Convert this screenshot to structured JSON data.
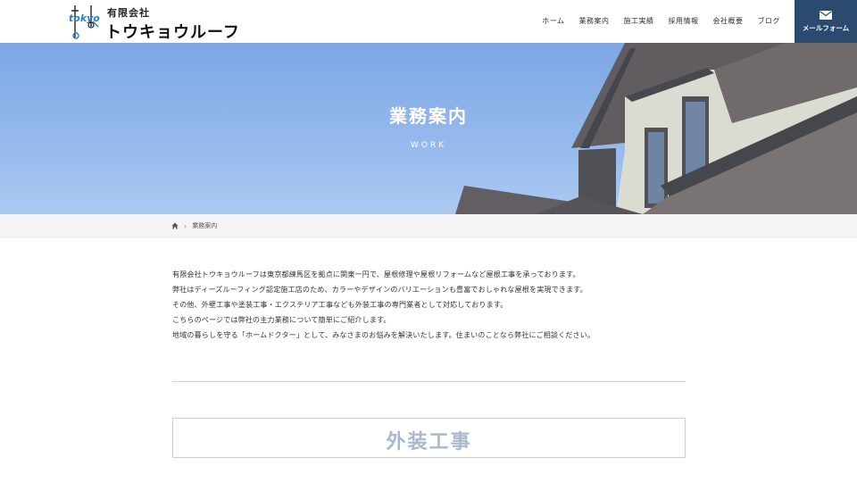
{
  "header": {
    "company_prefix": "有限会社",
    "company_name": "トウキョウルーフ",
    "logo_text": "tokyo",
    "nav": [
      "ホーム",
      "業務案内",
      "施工実績",
      "採用情報",
      "会社概要",
      "ブログ"
    ],
    "mail_button": "メールフォーム"
  },
  "hero": {
    "title": "業務案内",
    "subtitle": "WORK"
  },
  "breadcrumb": {
    "current": "業務案内"
  },
  "intro": {
    "lines": [
      "有限会社トウキョウルーフは東京都練馬区を拠点に関東一円で、屋根修理や屋根リフォームなど屋根工事を承っております。",
      "弊社はディーズルーフィング認定施工店のため、カラーやデザインのバリエーションも豊富でおしゃれな屋根を実現できます。",
      "その他、外壁工事や塗装工事・エクステリア工事なども外装工事の専門業者として対応しております。",
      "こちらのページでは弊社の主力業務について簡単にご紹介します。",
      "地域の暮らしを守る「ホームドクター」として、みなさまのお悩みを解決いたします。住まいのことなら弊社にご相談ください。"
    ]
  },
  "section": {
    "title": "外装工事"
  },
  "colors": {
    "accent": "#2c4a6e",
    "section_title": "#a9b8cc",
    "breadcrumb_bg": "#f4f4f4"
  }
}
